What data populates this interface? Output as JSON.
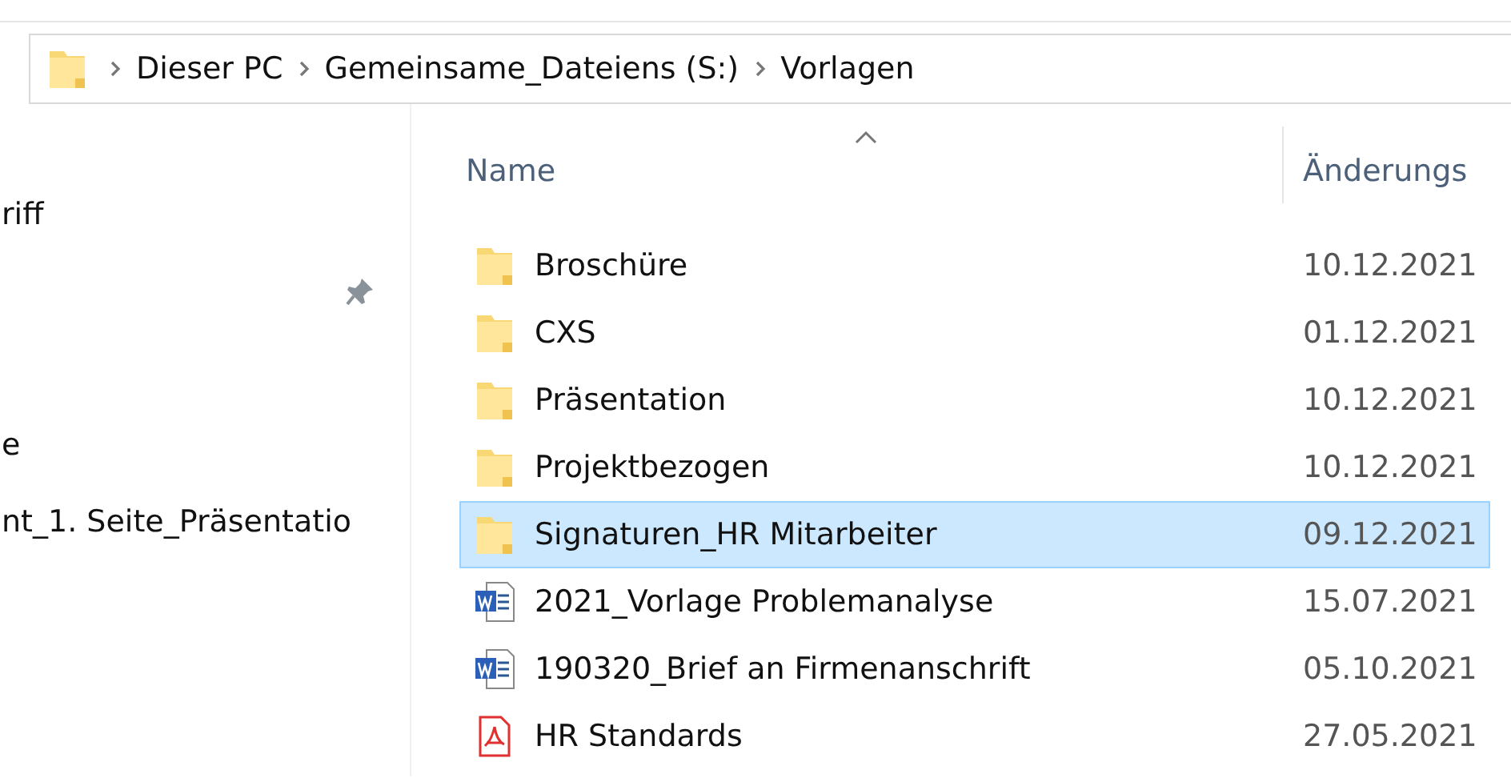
{
  "address_bar": {
    "crumbs": [
      "Dieser PC",
      "Gemeinsame_Dateiens (S:)",
      "Vorlagen"
    ]
  },
  "navigation_pane": {
    "groups": [
      {
        "items": [
          {
            "label": "riff",
            "pinned": false
          },
          {
            "pinned": true
          }
        ]
      },
      {
        "items": [
          {
            "label": "e",
            "pinned": false
          },
          {
            "label": "nt_1. Seite_Präsentatio",
            "pinned": false
          }
        ]
      }
    ]
  },
  "file_list": {
    "columns": [
      "Name",
      "Änderungs"
    ],
    "rows": [
      {
        "name": "Broschüre",
        "kind": "folder",
        "date": "10.12.2021",
        "selected": false
      },
      {
        "name": "CXS",
        "kind": "folder",
        "date": "01.12.2021",
        "selected": false
      },
      {
        "name": "Präsentation",
        "kind": "folder",
        "date": "10.12.2021",
        "selected": false
      },
      {
        "name": "Projektbezogen",
        "kind": "folder",
        "date": "10.12.2021",
        "selected": false
      },
      {
        "name": "Signaturen_HR Mitarbeiter",
        "kind": "folder",
        "date": "09.12.2021",
        "selected": true
      },
      {
        "name": "2021_Vorlage Problemanalyse",
        "kind": "word",
        "date": "15.07.2021",
        "selected": false
      },
      {
        "name": "190320_Brief an Firmenanschrift",
        "kind": "word",
        "date": "05.10.2021",
        "selected": false
      },
      {
        "name": "HR Standards",
        "kind": "pdf",
        "date": "27.05.2021",
        "selected": false
      }
    ]
  }
}
